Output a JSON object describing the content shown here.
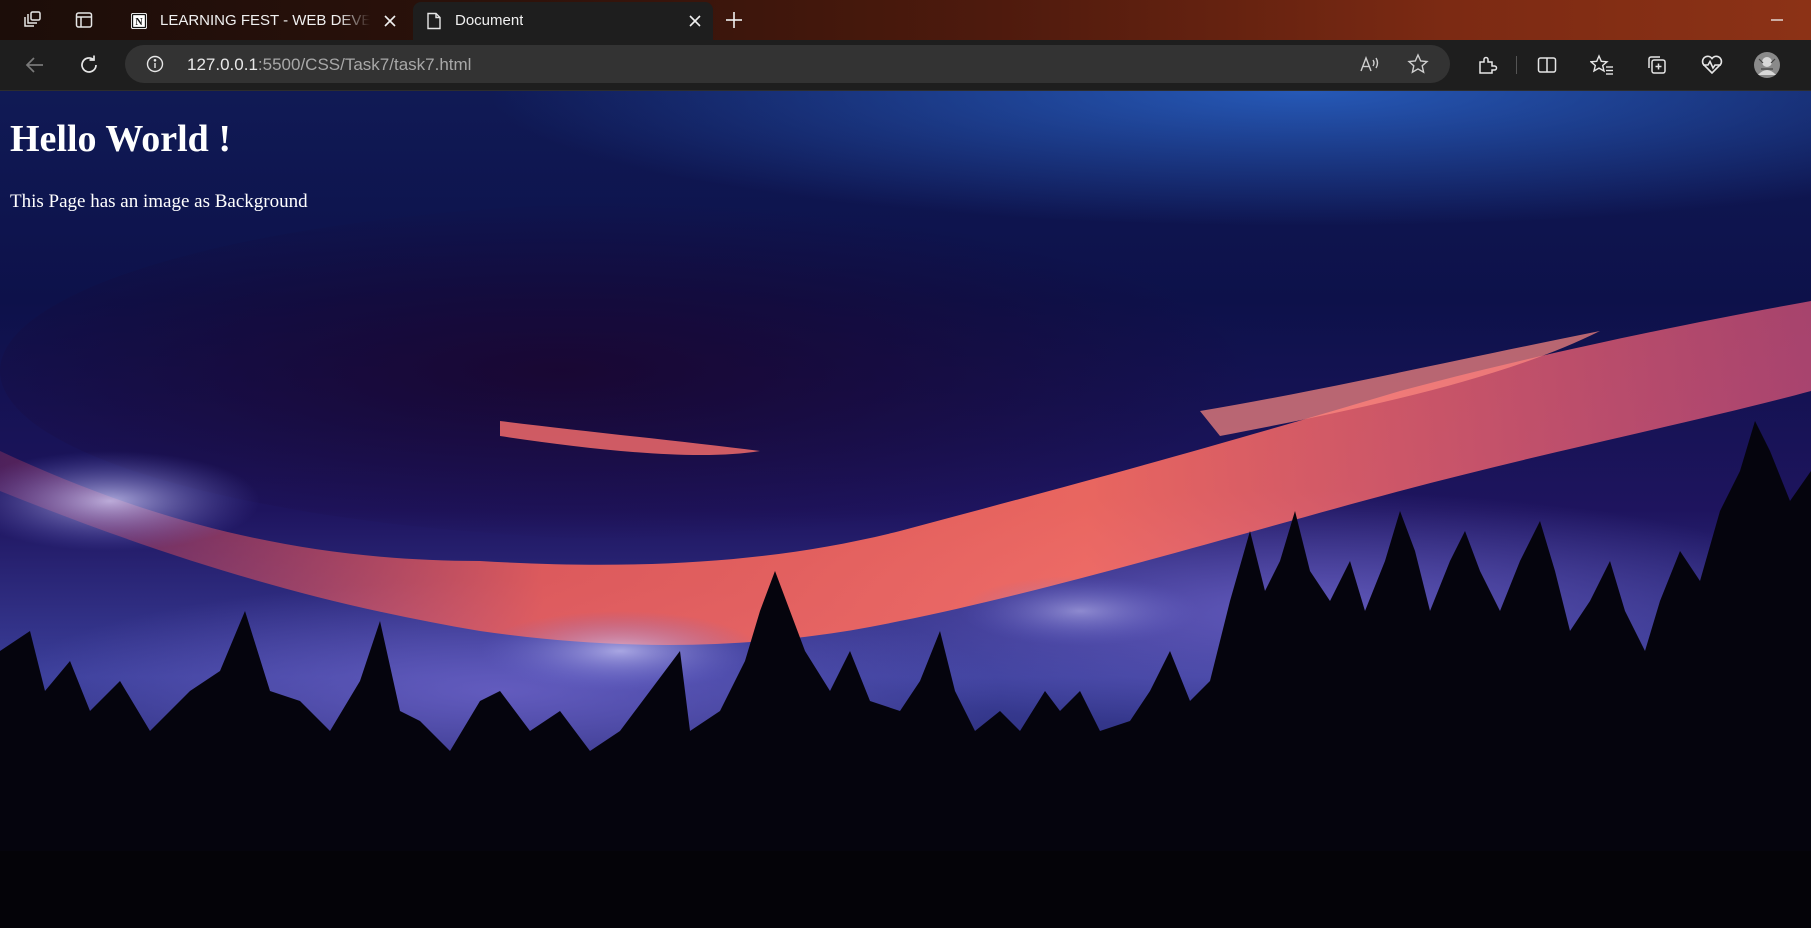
{
  "window": {
    "tabs": [
      {
        "title": "LEARNING FEST - WEB DEVELOPMENT",
        "favicon": "notion-icon",
        "active": false
      },
      {
        "title": "Document",
        "favicon": "page-icon",
        "active": true
      }
    ]
  },
  "toolbar": {
    "url_host": "127.0.0.1",
    "url_rest": ":5500/CSS/Task7/task7.html"
  },
  "page": {
    "heading": "Hello World !",
    "paragraph": "This Page has an image as Background"
  },
  "colors": {
    "tabbar_accent": "#7c2a13",
    "toolbar_bg": "#1e1e1e",
    "omnibox_bg": "#333333",
    "page_text": "#ffffff"
  }
}
